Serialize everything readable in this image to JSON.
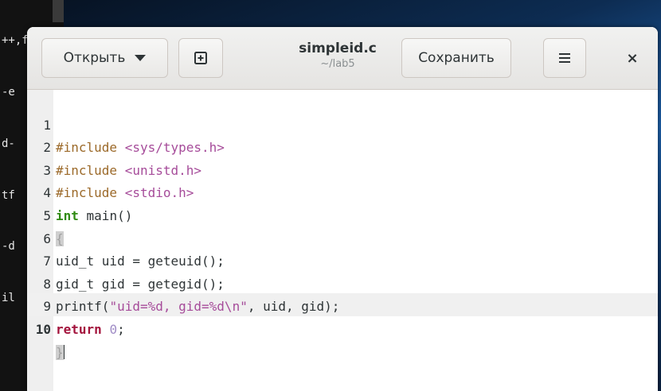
{
  "terminal": {
    "lines": [
      "++,f",
      "-e",
      "d-",
      "tf",
      "-d",
      "il"
    ]
  },
  "window": {
    "title": "simpleid.c",
    "subtitle": "~/lab5",
    "open_label": "Открыть",
    "save_label": "Сохранить",
    "close_symbol": "×",
    "menu_symbol": "≡",
    "new_tab_symbol": "⊞"
  },
  "editor": {
    "current_line": "10",
    "lines": [
      {
        "n": "1",
        "a": "#include ",
        "b": "<sys/types.h>"
      },
      {
        "n": "2",
        "a": "#include ",
        "b": "<unistd.h>"
      },
      {
        "n": "3",
        "a": "#include ",
        "b": "<stdio.h>"
      },
      {
        "n": "4",
        "kw": "int",
        "rest": " main()"
      },
      {
        "n": "5",
        "brace": "{"
      },
      {
        "n": "6",
        "text": "uid_t uid = geteuid();"
      },
      {
        "n": "7",
        "text": "gid_t gid = getegid();"
      },
      {
        "n": "8",
        "pre": "printf(",
        "str": "\"uid=%d, gid=%d\\n\"",
        "post": ", uid, gid);"
      },
      {
        "n": "9",
        "kw": "return",
        "sp": " ",
        "num": "0",
        "end": ";"
      },
      {
        "n": "10",
        "brace": "}"
      }
    ]
  }
}
